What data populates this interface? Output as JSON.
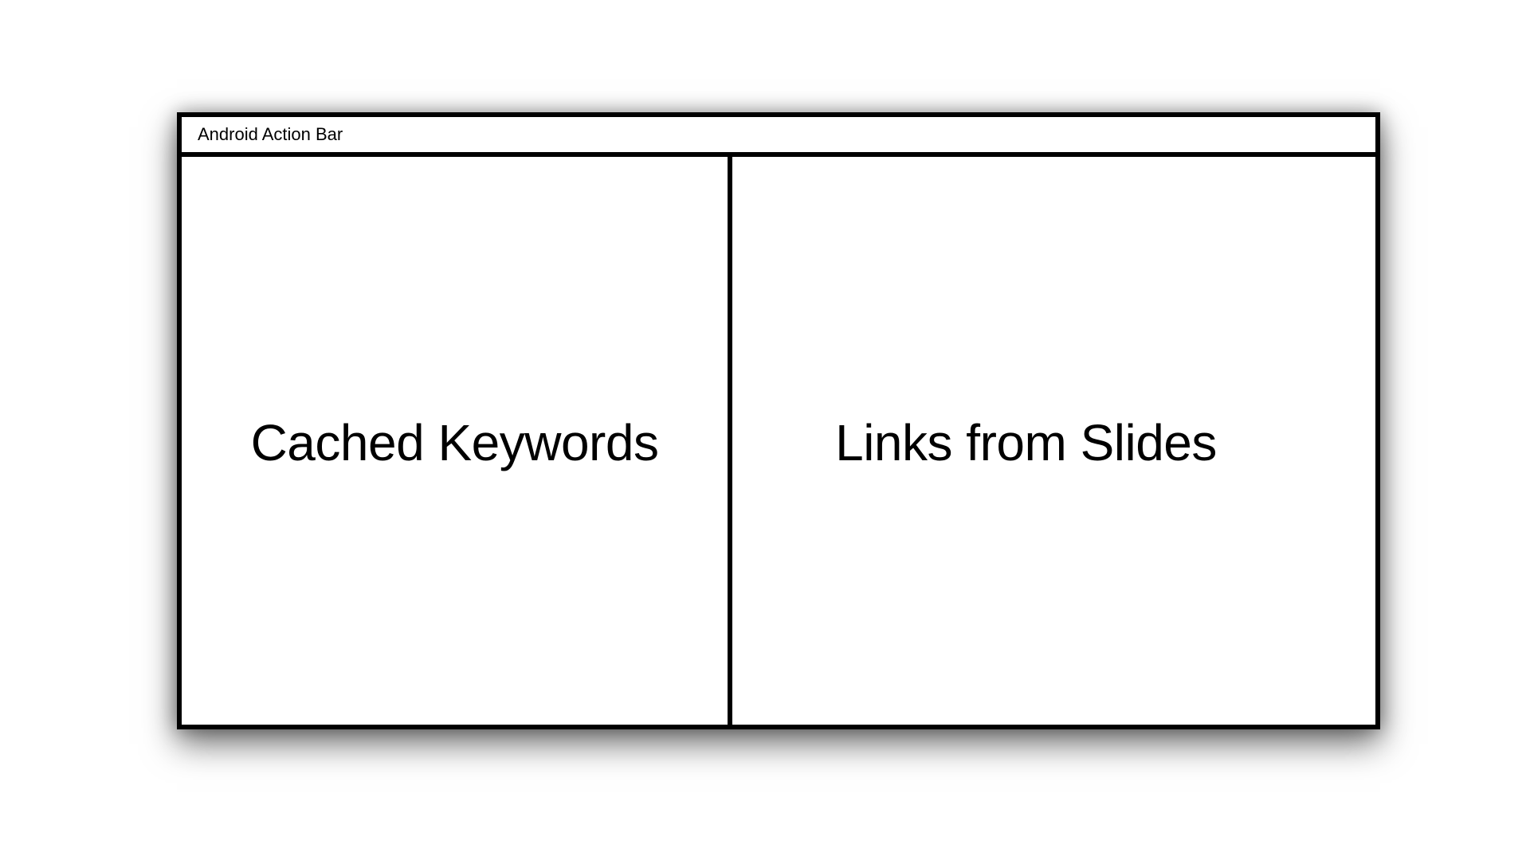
{
  "action_bar": {
    "title": "Android Action Bar"
  },
  "panes": {
    "left": {
      "label": "Cached Keywords"
    },
    "right": {
      "label": "Links from Slides"
    }
  },
  "colors": {
    "background": "#ffffff",
    "border": "#000000",
    "text": "#000000"
  }
}
